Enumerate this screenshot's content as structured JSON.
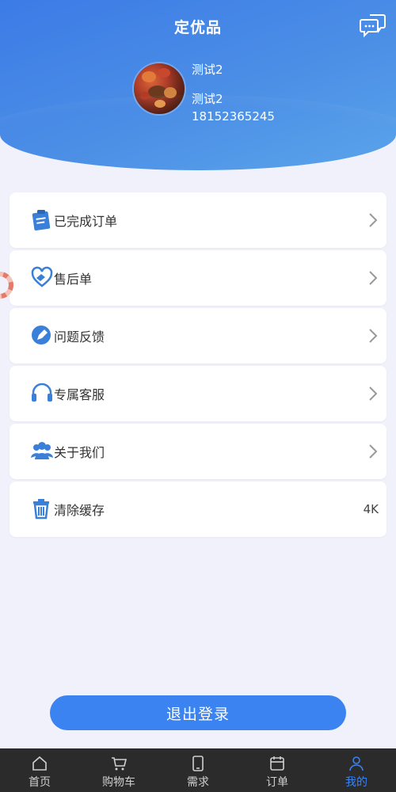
{
  "header": {
    "title": "定优品",
    "nickname": "测试2",
    "name": "测试2",
    "phone": "18152365245"
  },
  "menu": [
    {
      "label": "已完成订单",
      "icon": "order-clipboard-icon"
    },
    {
      "label": "售后单",
      "icon": "heart-hand-icon"
    },
    {
      "label": "问题反馈",
      "icon": "pencil-icon"
    },
    {
      "label": "专属客服",
      "icon": "headset-icon"
    },
    {
      "label": "关于我们",
      "icon": "users-icon"
    },
    {
      "label": "清除缓存",
      "icon": "trash-icon",
      "value": "4K"
    }
  ],
  "logout_label": "退出登录",
  "tabs": [
    {
      "label": "首页",
      "icon": "home-icon"
    },
    {
      "label": "购物车",
      "icon": "cart-icon"
    },
    {
      "label": "需求",
      "icon": "phone-icon"
    },
    {
      "label": "订单",
      "icon": "calendar-icon"
    },
    {
      "label": "我的",
      "icon": "user-icon",
      "active": true
    }
  ],
  "colors": {
    "accent": "#3b83f1",
    "header_start": "#3c7be6",
    "tabbar": "#2b2b2b"
  }
}
